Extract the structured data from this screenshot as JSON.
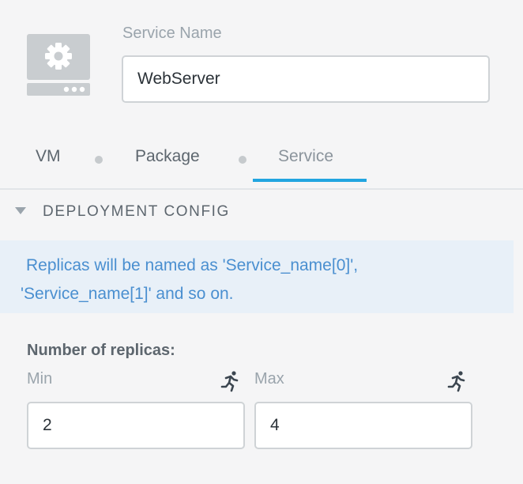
{
  "header": {
    "icon": "service-gear-icon",
    "service_name_label": "Service Name",
    "service_name_value": "WebServer"
  },
  "tabs": [
    {
      "label": "VM",
      "active": false
    },
    {
      "label": "Package",
      "active": false
    },
    {
      "label": "Service",
      "active": true
    }
  ],
  "section": {
    "title": "DEPLOYMENT CONFIG",
    "collapse_icon": "caret-down-icon",
    "info": "Replicas will be named as 'Service_name[0]', 'Service_name[1]' and so on."
  },
  "replicas": {
    "label": "Number of replicas:",
    "min": {
      "label": "Min",
      "value": "2",
      "icon": "running-person-icon"
    },
    "max": {
      "label": "Max",
      "value": "4",
      "icon": "running-person-icon"
    }
  },
  "colors": {
    "accent": "#22a5e0",
    "info_bg": "#e8f0f8",
    "info_text": "#4a8fd0"
  }
}
